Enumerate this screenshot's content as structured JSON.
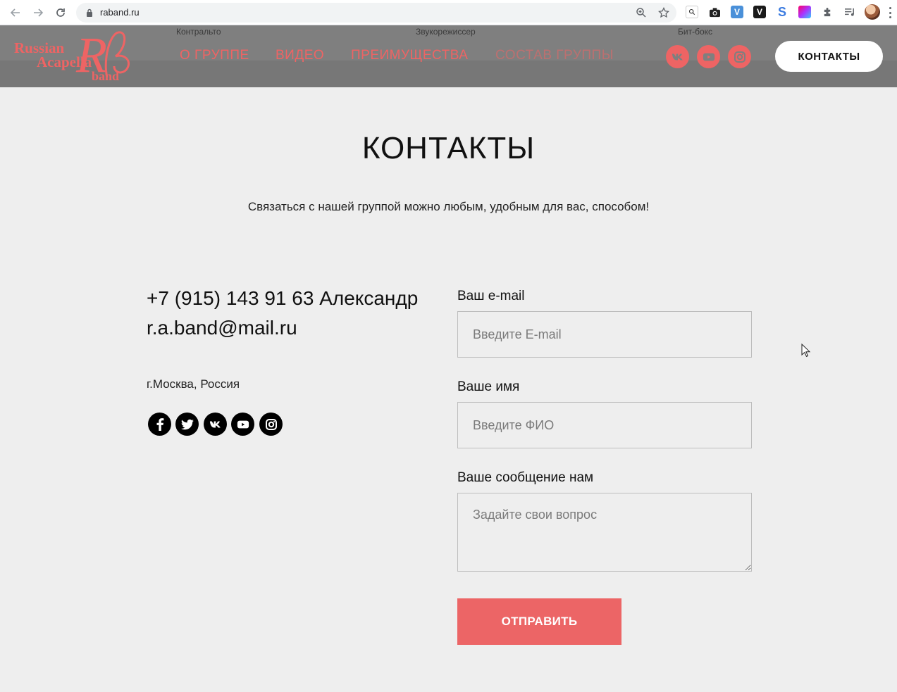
{
  "browser": {
    "url": "raband.ru"
  },
  "header": {
    "logo": {
      "line1": "Russian",
      "line2": "Acapella",
      "line3": "band",
      "monogram": "R"
    },
    "menu": [
      {
        "label": "О ГРУППЕ",
        "caption": "Контральто"
      },
      {
        "label": "ВИДЕО",
        "caption": ""
      },
      {
        "label": "ПРЕИМУЩЕСТВА",
        "caption": "Звукорежиссер"
      },
      {
        "label": "СОСТАВ ГРУППЫ",
        "caption": ""
      }
    ],
    "social_caption": "Бит-бокс",
    "contacts_button": "КОНТАКТЫ"
  },
  "main": {
    "title": "КОНТАКТЫ",
    "subtitle": "Связаться с нашей группой можно любым, удобным для вас, способом!",
    "phone": "+7 (915) 143 91 63 Александр",
    "email": "r.a.band@mail.ru",
    "city": "г.Москва, Россия"
  },
  "form": {
    "email_label": "Ваш e-mail",
    "email_placeholder": "Введите E-mail",
    "name_label": "Ваше имя",
    "name_placeholder": "Введите ФИО",
    "message_label": "Ваше сообщение нам",
    "message_placeholder": "Задайте свои вопрос",
    "submit": "ОТПРАВИТЬ"
  },
  "colors": {
    "accent": "#ec6566",
    "header_bg": "#7f7f7f",
    "page_bg": "#eeeeee"
  }
}
